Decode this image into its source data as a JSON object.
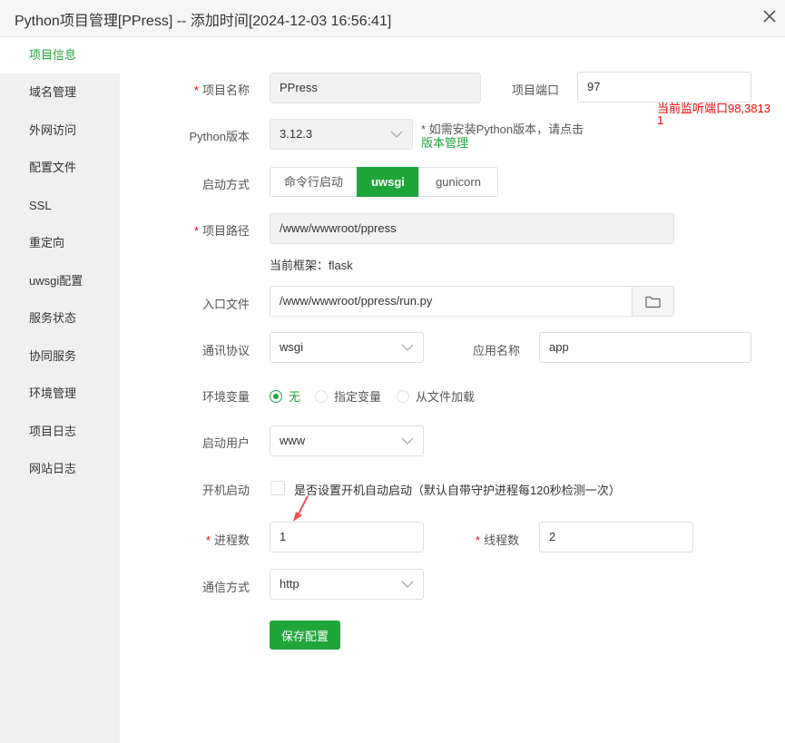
{
  "window": {
    "title": "Python项目管理[PPress] -- 添加时间[2024-12-03 16:56:41]"
  },
  "sidebar": {
    "items": [
      {
        "label": "项目信息"
      },
      {
        "label": "域名管理"
      },
      {
        "label": "外网访问"
      },
      {
        "label": "配置文件"
      },
      {
        "label": "SSL"
      },
      {
        "label": "重定向"
      },
      {
        "label": "uwsgi配置"
      },
      {
        "label": "服务状态"
      },
      {
        "label": "协同服务"
      },
      {
        "label": "环境管理"
      },
      {
        "label": "项目日志"
      },
      {
        "label": "网站日志"
      }
    ],
    "active_index": 0
  },
  "form": {
    "required_mark": "*",
    "project_name": {
      "label": "项目名称",
      "value": "PPress"
    },
    "project_port": {
      "label": "项目端口",
      "value": "97",
      "warning": "当前监听端口98,38131"
    },
    "python_version": {
      "label": "Python版本",
      "value": "3.12.3",
      "hint": "* 如需安装Python版本，请点击",
      "hint_link": "版本管理"
    },
    "start_method": {
      "label": "启动方式",
      "options": [
        "命令行启动",
        "uwsgi",
        "gunicorn"
      ],
      "selected": "uwsgi"
    },
    "project_path": {
      "label": "项目路径",
      "value": "/www/wwwroot/ppress",
      "framework_note": "当前框架：flask"
    },
    "entry_file": {
      "label": "入口文件",
      "value": "/www/wwwroot/ppress/run.py"
    },
    "protocol": {
      "label": "通讯协议",
      "value": "wsgi"
    },
    "app_name": {
      "label": "应用名称",
      "value": "app"
    },
    "env_vars": {
      "label": "环境变量",
      "options": [
        "无",
        "指定变量",
        "从文件加载"
      ],
      "selected": "无"
    },
    "run_user": {
      "label": "启动用户",
      "value": "www"
    },
    "autostart": {
      "label": "开机启动",
      "text": "是否设置开机自动启动（默认自带守护进程每120秒检测一次）",
      "checked": false
    },
    "processes": {
      "label": "进程数",
      "value": "1"
    },
    "threads": {
      "label": "线程数",
      "value": "2"
    },
    "comm_method": {
      "label": "通信方式",
      "value": "http"
    },
    "save_label": "保存配置"
  },
  "colors": {
    "accent": "#20a53a",
    "warning": "#ef0808",
    "annotation": "#f05454"
  },
  "icons": {
    "close": "close-icon",
    "folder": "folder-icon",
    "chevron": "chevron-down-icon",
    "annotation": "annotation-arrow"
  }
}
